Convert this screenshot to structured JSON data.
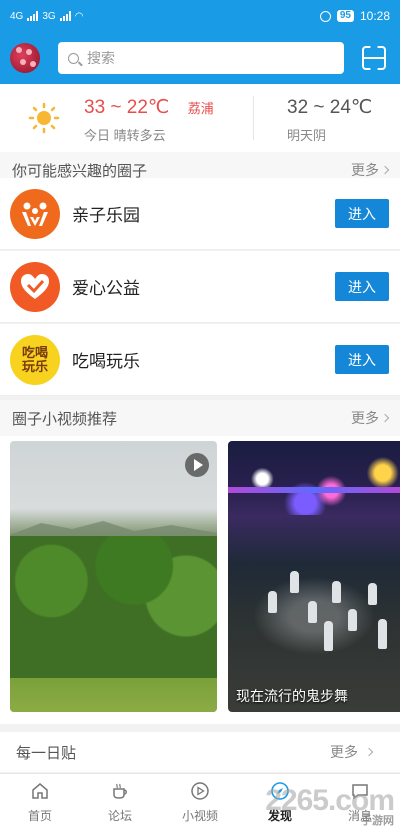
{
  "status_bar": {
    "signal1": "4G",
    "signal2": "3G",
    "battery": "95",
    "time": "10:28"
  },
  "header": {
    "search_placeholder": "搜索"
  },
  "weather": {
    "today_temp": "33 ~ 22℃",
    "today_city": "荔浦",
    "today_desc": "今日 晴转多云",
    "tomorrow_temp": "32 ~ 24℃",
    "tomorrow_desc": "明天阴"
  },
  "circles_section": {
    "title": "你可能感兴趣的圈子",
    "more": "更多",
    "items": [
      {
        "name": "亲子乐园",
        "join": "进入",
        "icon_color": "#f06a1e"
      },
      {
        "name": "爱心公益",
        "join": "进入",
        "icon_color": "#f15a24"
      },
      {
        "name": "吃喝玩乐",
        "join": "进入",
        "icon_color": "#f7d21e",
        "icon_text": "吃喝玩乐"
      }
    ]
  },
  "video_section": {
    "title": "圈子小视频推荐",
    "more": "更多",
    "videos": [
      {
        "caption": ""
      },
      {
        "caption": "现在流行的鬼步舞"
      }
    ]
  },
  "daily": {
    "title": "每一日贴",
    "more": "更多"
  },
  "tabbar": {
    "tabs": [
      {
        "label": "首页",
        "icon": "home-icon"
      },
      {
        "label": "论坛",
        "icon": "coffee-icon"
      },
      {
        "label": "小视频",
        "icon": "video-icon"
      },
      {
        "label": "发现",
        "icon": "discover-icon",
        "active": true
      },
      {
        "label": "消息",
        "icon": "message-icon"
      }
    ]
  },
  "watermark": {
    "brand": "2265.com",
    "sub": "手游网"
  },
  "colors": {
    "primary": "#1a9be6",
    "button": "#1587d8",
    "temp_today": "#e84d4d"
  }
}
